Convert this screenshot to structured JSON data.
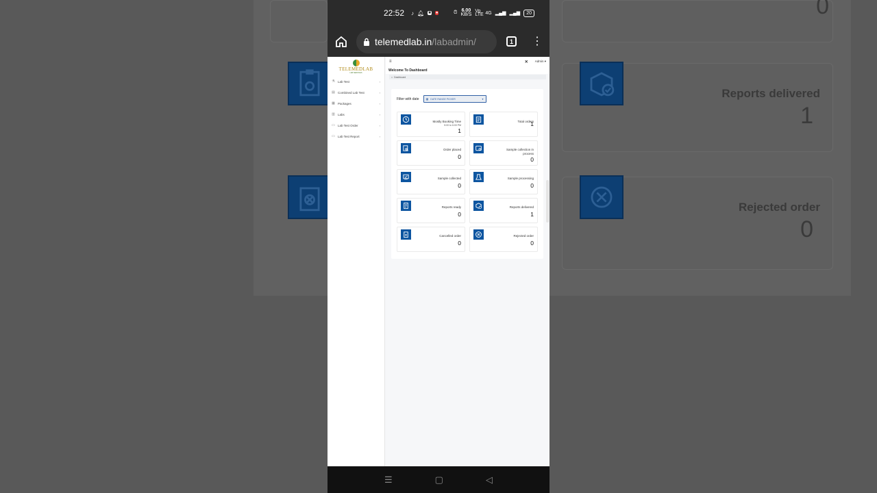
{
  "status": {
    "time": "22:52",
    "speed_top": "6.00",
    "speed_unit": "KB/S",
    "net1": "Vo LTE",
    "net2": "4G",
    "battery": "20"
  },
  "browser": {
    "url_domain": "telemedlab.in",
    "url_path": "/labadmin/",
    "tab_count": "1"
  },
  "logo": {
    "name": "TELEMEDLAB",
    "tagline": "LAB SERVICES"
  },
  "sidebar": {
    "items": [
      {
        "label": "Lab Test",
        "icon": "flask-icon"
      },
      {
        "label": "Combined Lab Test",
        "icon": "document-icon"
      },
      {
        "label": "Packages",
        "icon": "package-icon"
      },
      {
        "label": "Labs",
        "icon": "building-icon"
      },
      {
        "label": "Lab Test Order",
        "icon": "order-icon"
      },
      {
        "label": "Lab Test Report",
        "icon": "report-icon"
      }
    ]
  },
  "header": {
    "admin": "Admin ▾",
    "welcome": "Welcome To Dashboard",
    "breadcrumb": "Dashboard"
  },
  "filter": {
    "label": "Filter with date",
    "picker": "DATE RANGE PICKER"
  },
  "cards": [
    {
      "title": "Mostly Booking Time",
      "sub": "5:00 to 6:00 PM",
      "value": "1",
      "icon": "clock-icon"
    },
    {
      "title": "Total orders",
      "sub": "",
      "value": "1",
      "icon": "clipboard-icon"
    },
    {
      "title": "Order placed",
      "sub": "",
      "value": "0",
      "icon": "order-icon"
    },
    {
      "title": "Sample collection in process",
      "sub": "",
      "value": "0",
      "icon": "collection-icon"
    },
    {
      "title": "Sample collected",
      "sub": "",
      "value": "0",
      "icon": "sample-icon"
    },
    {
      "title": "Sample processing",
      "sub": "",
      "value": "0",
      "icon": "processing-icon"
    },
    {
      "title": "Reports ready",
      "sub": "",
      "value": "0",
      "icon": "report-icon"
    },
    {
      "title": "Reports delivered",
      "sub": "",
      "value": "1",
      "icon": "delivered-icon"
    },
    {
      "title": "Cancelled order",
      "sub": "",
      "value": "0",
      "icon": "cancel-icon"
    },
    {
      "title": "Rejected order",
      "sub": "",
      "value": "0",
      "icon": "reject-icon"
    }
  ],
  "background": {
    "top_value": "0",
    "reports_delivered": "Reports delivered",
    "reports_delivered_value": "1",
    "rejected_order": "Rejected order",
    "rejected_order_value": "0"
  },
  "colors": {
    "brand_blue": "#0d55a0",
    "chrome_dark": "#2b2b2b"
  }
}
